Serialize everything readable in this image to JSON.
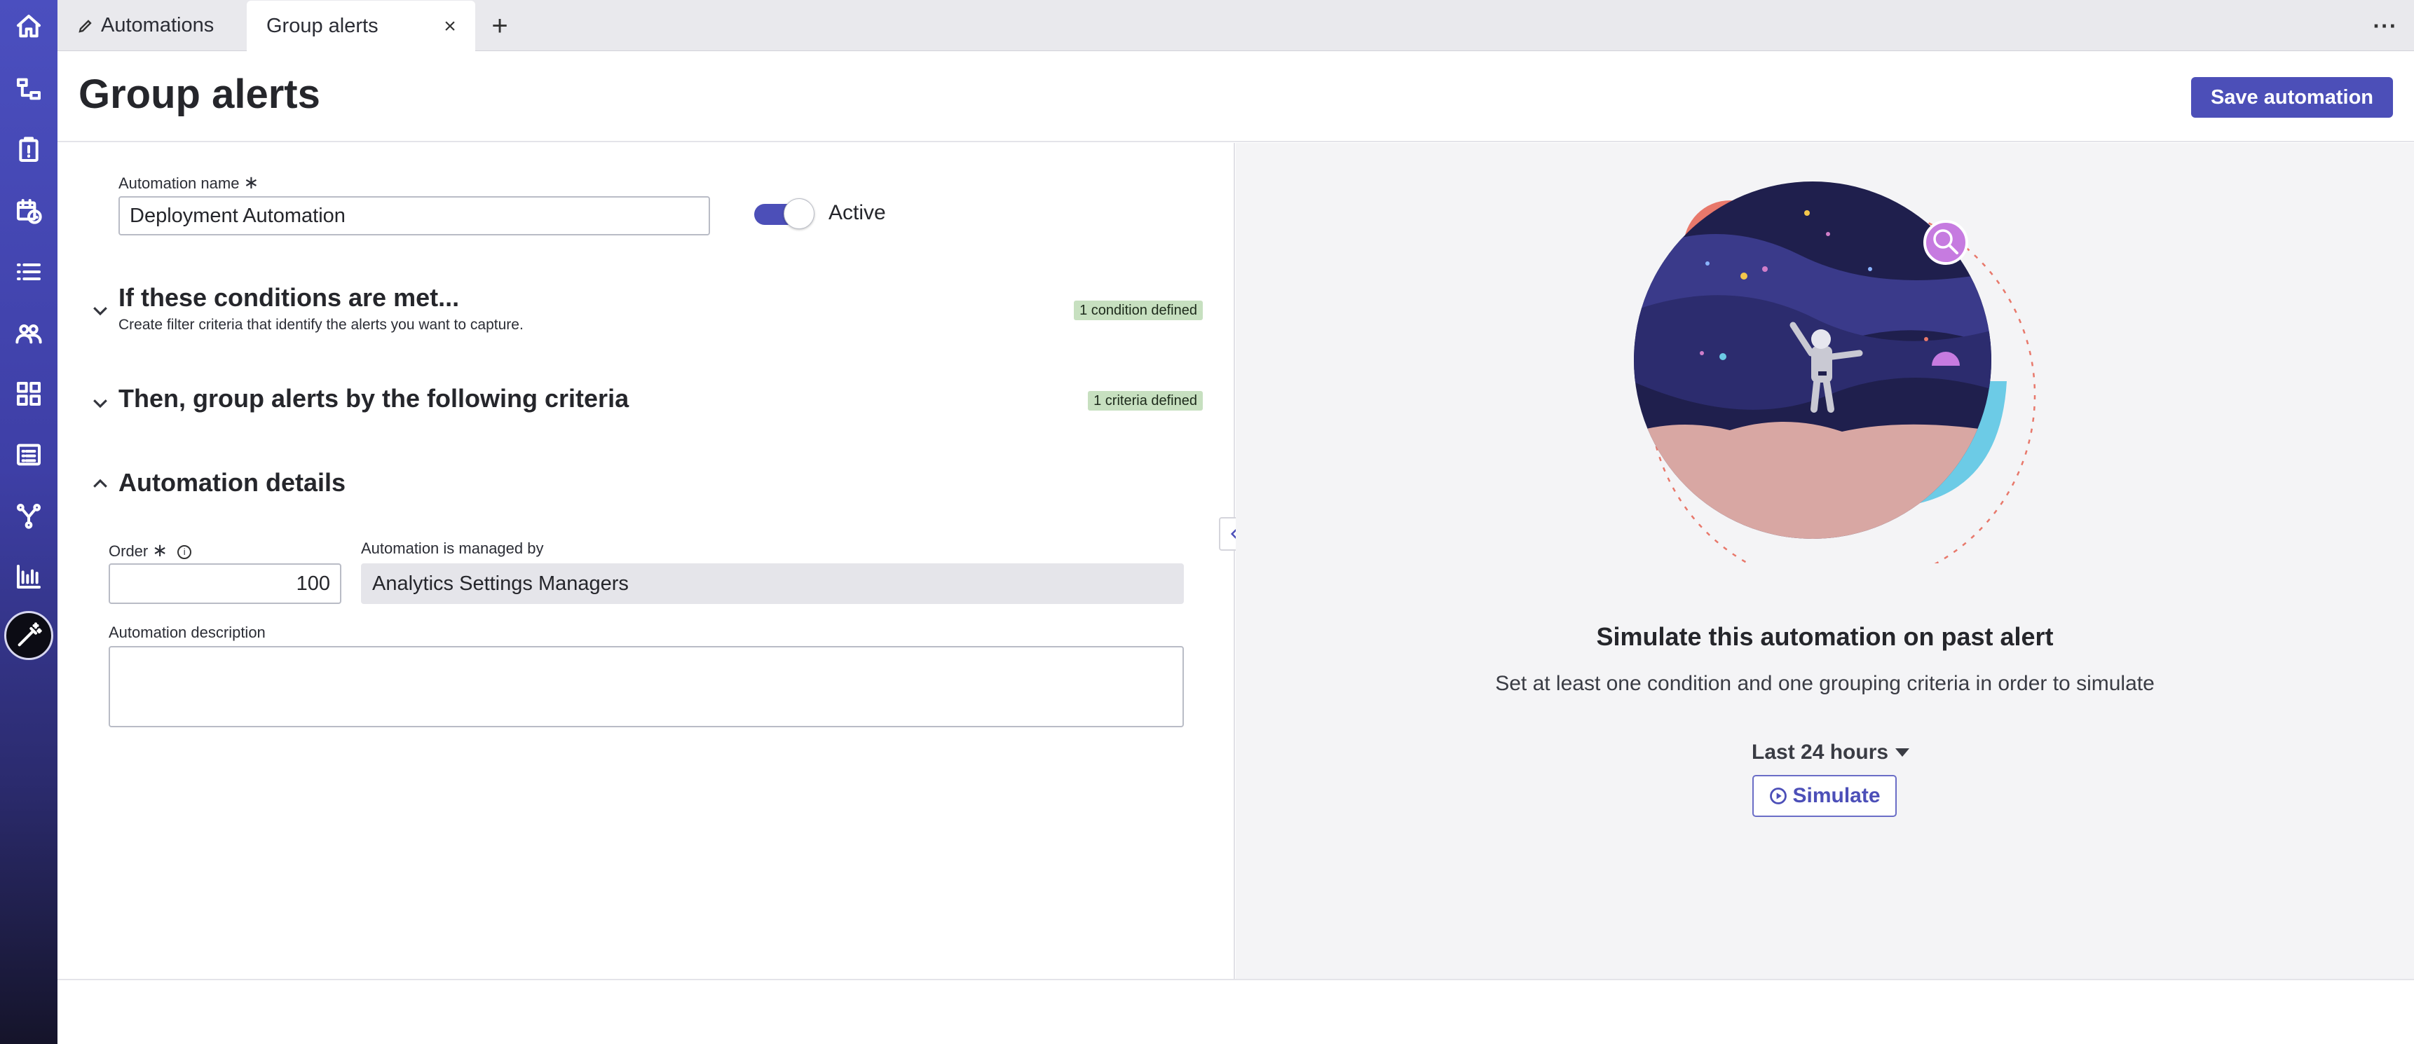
{
  "tabs": {
    "first_label": "Automations",
    "active_label": "Group alerts"
  },
  "header": {
    "title": "Group alerts",
    "save_label": "Save automation"
  },
  "form": {
    "name_label": "Automation name",
    "name_value": "Deployment Automation",
    "active_label": "Active",
    "active": true,
    "required_mark": "∗"
  },
  "sections": {
    "conditions": {
      "title": "If these conditions are met...",
      "subtitle": "Create filter criteria that identify the alerts you want to capture.",
      "badge": "1 condition defined"
    },
    "grouping": {
      "title": "Then, group alerts by the following criteria",
      "badge": "1 criteria defined"
    },
    "details": {
      "title": "Automation details",
      "order_label": "Order",
      "order_value": "100",
      "managed_label": "Automation is managed by",
      "managed_value": "Analytics Settings Managers",
      "description_label": "Automation description",
      "description_value": ""
    }
  },
  "simulate": {
    "title": "Simulate this automation on past alert",
    "subtitle": "Set at least one condition and one grouping criteria in order to simulate",
    "range": "Last 24 hours",
    "button_label": "Simulate"
  },
  "colors": {
    "accent": "#4c4fb8",
    "badge_bg": "#c7e0c0"
  }
}
